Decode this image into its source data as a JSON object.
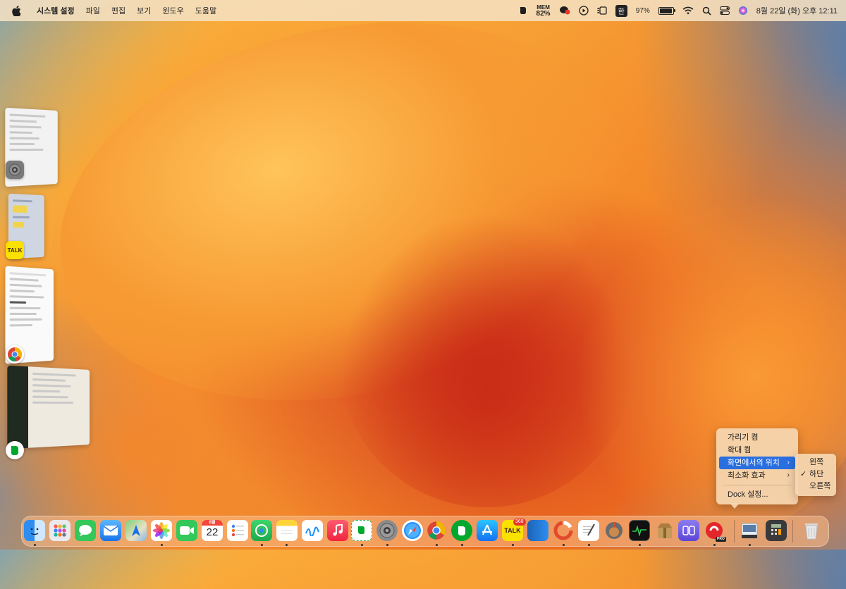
{
  "menubar": {
    "app_name": "시스템 설정",
    "items": [
      "파일",
      "편집",
      "보기",
      "윈도우",
      "도움말"
    ],
    "mem_label": "MEM",
    "mem_value": "82%",
    "input_source": "한",
    "battery_percent": "97%",
    "battery_level": 0.97,
    "clock": "8월 22일 (화) 오후 12:11"
  },
  "stage_manager": {
    "groups": [
      {
        "app": "system-settings",
        "icon": "gear-icon"
      },
      {
        "app": "kakaotalk",
        "icon_label": "TALK"
      },
      {
        "app": "chrome",
        "icon": "chrome-icon"
      },
      {
        "app": "evernote",
        "icon": "evernote-icon"
      }
    ]
  },
  "context_menu": {
    "items": [
      {
        "label": "가리기 켬"
      },
      {
        "label": "확대 켬"
      },
      {
        "label": "화면에서의 위치",
        "has_submenu": true,
        "active": true
      },
      {
        "label": "최소화 효과",
        "has_submenu": true
      },
      {
        "label": "Dock 설정..."
      }
    ],
    "submenu": {
      "items": [
        {
          "label": "왼쪽",
          "checked": false
        },
        {
          "label": "하단",
          "checked": true
        },
        {
          "label": "오른쪽",
          "checked": false
        }
      ]
    }
  },
  "dock": {
    "calendar_month": "8월",
    "calendar_day": "22",
    "kakao_badge": "368",
    "kakao_label": "TALK",
    "pro_label": "PRO",
    "apps": [
      "finder",
      "launchpad",
      "messages",
      "mail",
      "maps",
      "photos",
      "facetime",
      "calendar",
      "reminders",
      "find-my",
      "notes",
      "freeform",
      "music",
      "evernote-clip",
      "system-settings",
      "safari",
      "chrome",
      "evernote",
      "app-store",
      "kakaotalk",
      "bluebook",
      "istat",
      "textedit",
      "disk-utility",
      "activity-monitor",
      "archive-utility",
      "bbedit",
      "pdf-pro",
      "preview",
      "calculator",
      "trash"
    ]
  },
  "colors": {
    "accent": "#2a6fe0",
    "menu_bg": "#f5d6b0"
  }
}
